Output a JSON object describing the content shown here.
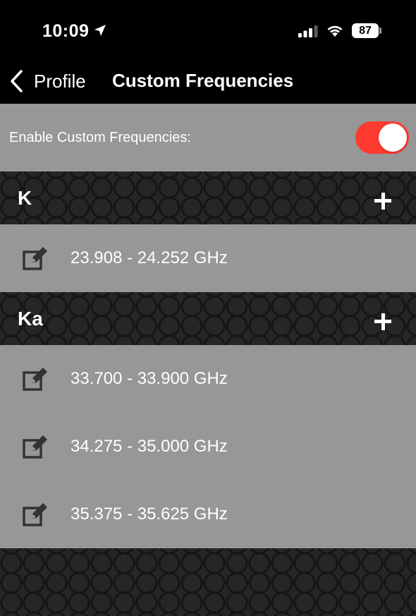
{
  "status": {
    "time": "10:09",
    "battery": "87",
    "location_icon": "location-arrow-icon",
    "signal_icon": "cellular-signal-icon",
    "wifi_icon": "wifi-icon"
  },
  "nav": {
    "back_label": "Profile",
    "title": "Custom Frequencies"
  },
  "custom_toggle": {
    "label": "Enable Custom Frequencies:",
    "enabled": true,
    "on_color": "#ff3b30"
  },
  "sections": [
    {
      "title": "K",
      "items": [
        "23.908 - 24.252 GHz"
      ]
    },
    {
      "title": "Ka",
      "items": [
        "33.700 - 33.900 GHz",
        "34.275 - 35.000 GHz",
        "35.375 - 35.625 GHz"
      ]
    }
  ]
}
